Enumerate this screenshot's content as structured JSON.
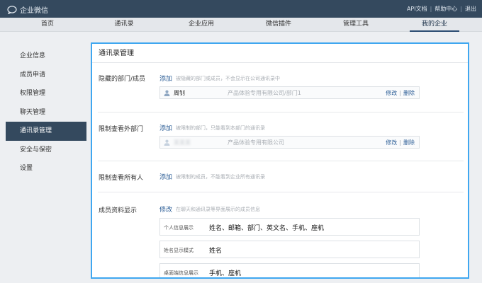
{
  "app": {
    "name": "企业微信"
  },
  "toplinks": {
    "api_docs": "API文档",
    "help": "帮助中心",
    "logout": "退出",
    "sep": "|"
  },
  "nav": {
    "items": [
      {
        "label": "首页"
      },
      {
        "label": "通讯录"
      },
      {
        "label": "企业应用"
      },
      {
        "label": "微信插件"
      },
      {
        "label": "管理工具"
      },
      {
        "label": "我的企业"
      }
    ],
    "active_index": 5
  },
  "sidebar": {
    "items": [
      {
        "label": "企业信息"
      },
      {
        "label": "成员申请"
      },
      {
        "label": "权限管理"
      },
      {
        "label": "聊天管理"
      },
      {
        "label": "通讯录管理"
      },
      {
        "label": "安全与保密"
      },
      {
        "label": "设置"
      }
    ],
    "active_index": 4
  },
  "panel": {
    "title": "通讯录管理",
    "hidden": {
      "label": "隐藏的部门/成员",
      "action": "添加",
      "hint": "被隐藏的部门或成员，不会显示在公司通讯录中",
      "member": {
        "name": "周钊",
        "dept": "产品体验专用有限公司/部门1",
        "edit": "修改",
        "delete": "删除",
        "bar": "|"
      }
    },
    "restrict_external": {
      "label": "限制查看外部门",
      "action": "添加",
      "hint": "被限制的部门，只能看到本部门的通讯录",
      "member": {
        "name": "某某某",
        "dept": "产品体验专用有限公司",
        "edit": "修改",
        "delete": "删除",
        "bar": "|"
      }
    },
    "restrict_all": {
      "label": "限制查看所有人",
      "action": "添加",
      "hint": "被限制的成员，不能看到企业所有通讯录"
    },
    "member_info": {
      "label": "成员资料显示",
      "action": "修改",
      "hint": "在聊天和通讯录等界面展示的成员信息",
      "fields": [
        {
          "label": "个人信息展示",
          "value": "姓名、邮箱、部门、英文名、手机、座机"
        },
        {
          "label": "姓名显示模式",
          "value": "姓名"
        },
        {
          "label": "桌面端信息展示",
          "value": "手机、座机"
        }
      ]
    }
  }
}
